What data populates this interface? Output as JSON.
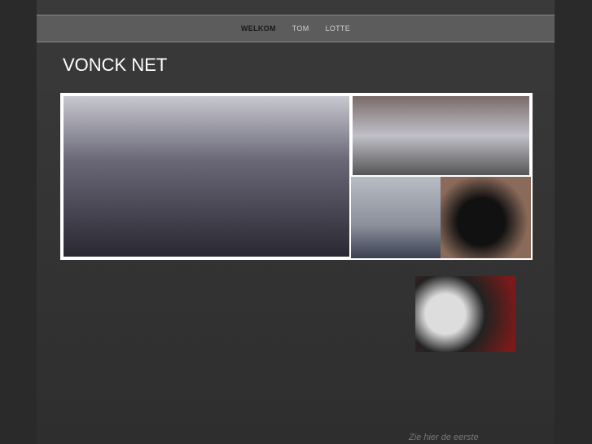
{
  "nav": {
    "items": [
      {
        "label": "WELKOM",
        "active": true
      },
      {
        "label": "TOM"
      },
      {
        "label": "LOTTE"
      }
    ]
  },
  "header": {
    "title": "VONCK NET"
  },
  "footer": {
    "text": "Zie hier de eerste"
  }
}
